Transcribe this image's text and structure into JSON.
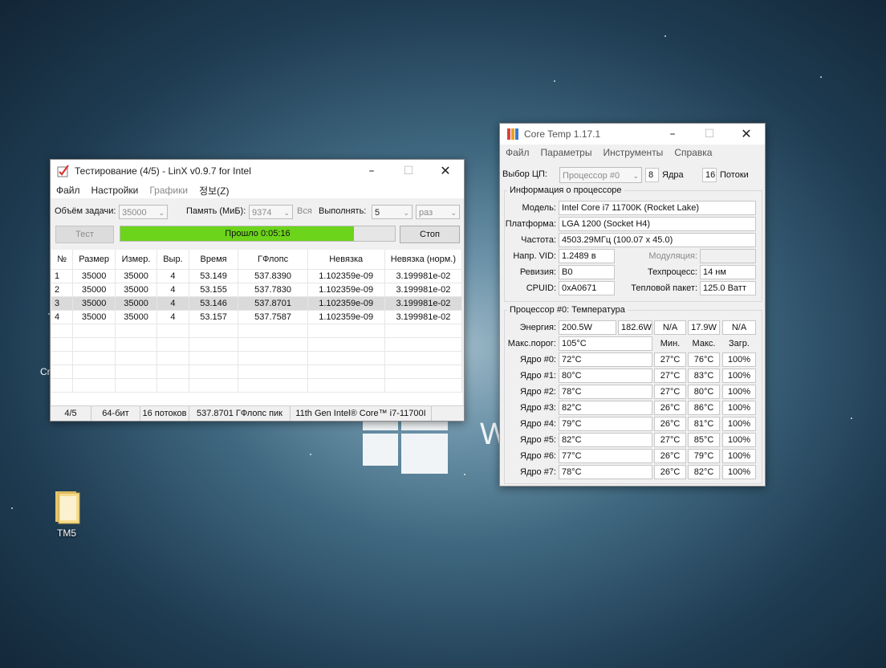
{
  "desktop": {
    "icon_label": "TM5",
    "partial_text_left": "Cr",
    "partial_text_mid": "W"
  },
  "linx": {
    "title": "Тестирование (4/5) - LinX v0.9.7 for Intel",
    "menu": [
      "Файл",
      "Настройки",
      "Графики",
      "정보(Z)"
    ],
    "task_size_label": "Объём задачи:",
    "task_size_value": "35000",
    "memory_label": "Память (МиБ):",
    "memory_value": "9374",
    "memory_all": "Вся",
    "run_label": "Выполнять:",
    "run_value": "5",
    "run_unit": "раз",
    "test_button": "Тест",
    "progress_text": "Прошло 0:05:16",
    "progress_fraction": 0.85,
    "stop_button": "Стоп",
    "columns": [
      "№",
      "Размер",
      "Измер.",
      "Выр.",
      "Время",
      "ГФлопс",
      "Невязка",
      "Невязка (норм.)"
    ],
    "rows": [
      [
        "1",
        "35000",
        "35000",
        "4",
        "53.149",
        "537.8390",
        "1.102359e-09",
        "3.199981e-02"
      ],
      [
        "2",
        "35000",
        "35000",
        "4",
        "53.155",
        "537.7830",
        "1.102359e-09",
        "3.199981e-02"
      ],
      [
        "3",
        "35000",
        "35000",
        "4",
        "53.146",
        "537.8701",
        "1.102359e-09",
        "3.199981e-02"
      ],
      [
        "4",
        "35000",
        "35000",
        "4",
        "53.157",
        "537.7587",
        "1.102359e-09",
        "3.199981e-02"
      ]
    ],
    "selected_row": 2,
    "status": [
      "4/5",
      "64-бит",
      "16 потоков",
      "537.8701 ГФлопс пик",
      "11th Gen Intel® Core™ i7-11700I"
    ]
  },
  "coretemp": {
    "title": "Core Temp 1.17.1",
    "menu": [
      "Файл",
      "Параметры",
      "Инструменты",
      "Справка"
    ],
    "cpu_select_label": "Выбор ЦП:",
    "cpu_select_value": "Процессор #0",
    "cores": "8",
    "cores_label": "Ядра",
    "threads": "16",
    "threads_label": "Потоки",
    "info_group": "Информация о процессоре",
    "model_label": "Модель:",
    "model": "Intel Core i7 11700K (Rocket Lake)",
    "platform_label": "Платформа:",
    "platform": "LGA 1200 (Socket H4)",
    "freq_label": "Частота:",
    "freq": "4503.29МГц (100.07 x 45.0)",
    "vid_label": "Напр. VID:",
    "vid": "1.2489 в",
    "modulation_label": "Модуляция:",
    "modulation": "",
    "revision_label": "Ревизия:",
    "revision": "B0",
    "process_label": "Техпроцесс:",
    "process": "14 нм",
    "cpuid_label": "CPUID:",
    "cpuid": "0xA0671",
    "tdp_label": "Тепловой пакет:",
    "tdp": "125.0 Ватт",
    "temp_group": "Процессор #0: Температура",
    "power_label": "Энергия:",
    "power": [
      "200.5W",
      "182.6W",
      "N/A",
      "17.9W",
      "N/A"
    ],
    "tjmax_label": "Макс.порог:",
    "tjmax": "105°C",
    "col_min": "Мин.",
    "col_max": "Макс.",
    "col_load": "Загр.",
    "core_rows": [
      {
        "label": "Ядро #0:",
        "temp": "72°C",
        "min": "27°C",
        "max": "76°C",
        "load": "100%"
      },
      {
        "label": "Ядро #1:",
        "temp": "80°C",
        "min": "27°C",
        "max": "83°C",
        "load": "100%"
      },
      {
        "label": "Ядро #2:",
        "temp": "78°C",
        "min": "27°C",
        "max": "80°C",
        "load": "100%"
      },
      {
        "label": "Ядро #3:",
        "temp": "82°C",
        "min": "26°C",
        "max": "86°C",
        "load": "100%"
      },
      {
        "label": "Ядро #4:",
        "temp": "79°C",
        "min": "26°C",
        "max": "81°C",
        "load": "100%"
      },
      {
        "label": "Ядро #5:",
        "temp": "82°C",
        "min": "27°C",
        "max": "85°C",
        "load": "100%"
      },
      {
        "label": "Ядро #6:",
        "temp": "77°C",
        "min": "26°C",
        "max": "79°C",
        "load": "100%"
      },
      {
        "label": "Ядро #7:",
        "temp": "78°C",
        "min": "26°C",
        "max": "82°C",
        "load": "100%"
      }
    ]
  }
}
